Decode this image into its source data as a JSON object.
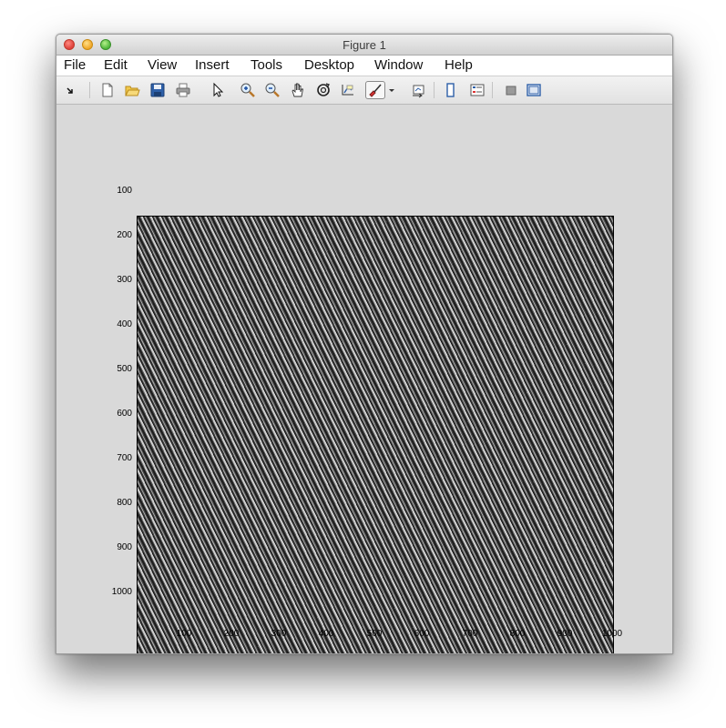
{
  "window": {
    "title": "Figure 1"
  },
  "menu": [
    "File",
    "Edit",
    "View",
    "Insert",
    "Tools",
    "Desktop",
    "Window",
    "Help"
  ],
  "toolbar": {
    "icons": [
      "dock-arrow-icon",
      "new-figure-icon",
      "open-file-icon",
      "save-icon",
      "print-icon",
      "select-pointer-icon",
      "zoom-in-icon",
      "zoom-out-icon",
      "pan-hand-icon",
      "rotate-3d-icon",
      "data-cursor-icon",
      "brush-icon",
      "brush-dropdown-icon",
      "link-plot-icon",
      "colorbar-icon",
      "legend-icon",
      "hide-plot-tools-icon",
      "show-plot-tools-icon"
    ]
  },
  "axes": {
    "yticks": [
      "100",
      "200",
      "300",
      "400",
      "500",
      "600",
      "700",
      "800",
      "900",
      "1000"
    ],
    "xticks": [
      "100",
      "200",
      "300",
      "400",
      "500",
      "600",
      "700",
      "800",
      "900",
      "1000"
    ]
  },
  "chart_data": {
    "type": "heatmap",
    "colormap": "gray",
    "title": "",
    "xlabel": "",
    "ylabel": "",
    "xlim": [
      1,
      1000
    ],
    "ylim": [
      1,
      1000
    ],
    "y_reversed": true,
    "xticks": [
      100,
      200,
      300,
      400,
      500,
      600,
      700,
      800,
      900,
      1000
    ],
    "yticks": [
      100,
      200,
      300,
      400,
      500,
      600,
      700,
      800,
      900,
      1000
    ],
    "grid": false
  }
}
